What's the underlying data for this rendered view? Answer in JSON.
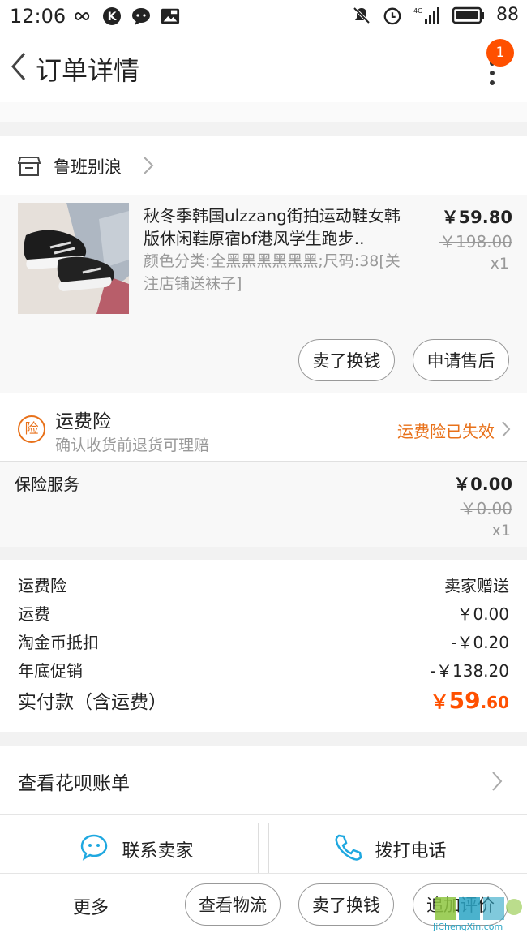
{
  "status_bar": {
    "time": "12:06",
    "battery": "88",
    "network": "4G"
  },
  "header": {
    "title": "订单详情",
    "badge_count": "1"
  },
  "shop": {
    "name": "鲁班别浪"
  },
  "product": {
    "title": "秋冬季韩国ulzzang街拍运动鞋女韩版休闲鞋原宿bf港风学生跑步..",
    "spec": "颜色分类:全黑黑黑黑黑黑;尺码:38[关注店铺送袜子]",
    "price": "￥59.80",
    "original_price": "￥198.00",
    "quantity": "x1",
    "actions": [
      "卖了换钱",
      "申请售后"
    ]
  },
  "shipping_insurance": {
    "title": "运费险",
    "subtitle": "确认收货前退货可理赔",
    "status": "运费险已失效",
    "icon_text": "险"
  },
  "insurance_service": {
    "label": "保险服务",
    "price": "￥0.00",
    "original_price": "￥0.00",
    "quantity": "x1"
  },
  "summary": {
    "rows": [
      {
        "label": "运费险",
        "value": "卖家赠送"
      },
      {
        "label": "运费",
        "value": "￥0.00"
      },
      {
        "label": "淘金币抵扣",
        "value": "-￥0.20"
      },
      {
        "label": "年底促销",
        "value": "-￥138.20"
      }
    ],
    "total_label": "实付款（含运费）",
    "total_currency": "￥",
    "total_int": "59",
    "total_dec": ".60"
  },
  "huabei": {
    "label": "查看花呗账单"
  },
  "contact": {
    "seller": "联系卖家",
    "phone": "拨打电话"
  },
  "bottom_bar": {
    "more": "更多",
    "buttons": [
      "查看物流",
      "卖了换钱",
      "追加评价"
    ]
  },
  "watermark": {
    "text": "JiChengXin.com"
  },
  "colors": {
    "accent": "#ff5000",
    "insurance": "#e8711a",
    "contact_icon": "#1fa8e0"
  }
}
